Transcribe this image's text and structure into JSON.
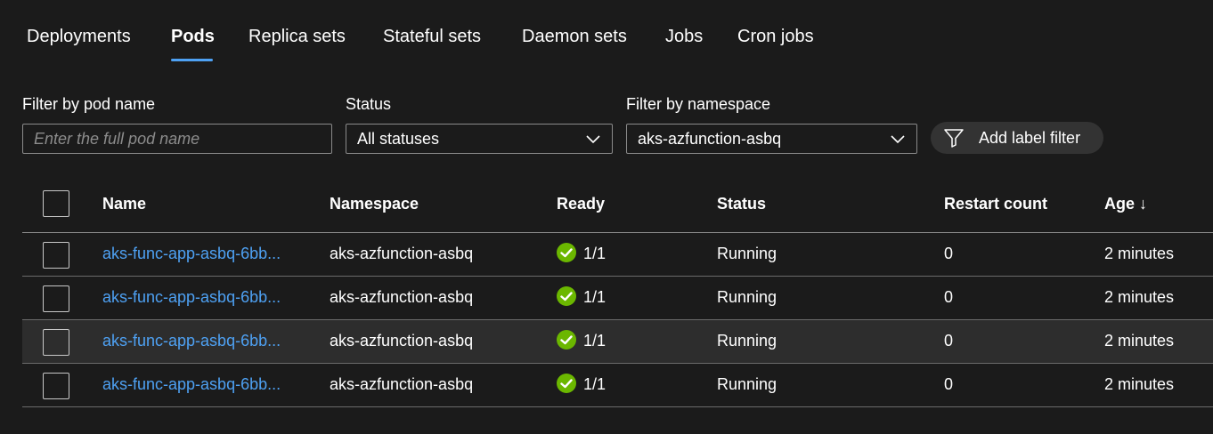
{
  "tabs": {
    "deployments": "Deployments",
    "pods": "Pods",
    "replica_sets": "Replica sets",
    "stateful_sets": "Stateful sets",
    "daemon_sets": "Daemon sets",
    "jobs": "Jobs",
    "cron_jobs": "Cron jobs",
    "active": "Pods"
  },
  "filters": {
    "pod_name_label": "Filter by pod name",
    "pod_name_placeholder": "Enter the full pod name",
    "pod_name_value": "",
    "status_label": "Status",
    "status_value": "All statuses",
    "namespace_label": "Filter by namespace",
    "namespace_value": "aks-azfunction-asbq",
    "add_label_filter": "Add label filter"
  },
  "table": {
    "columns": {
      "name": "Name",
      "namespace": "Namespace",
      "ready": "Ready",
      "status": "Status",
      "restart_count": "Restart count",
      "age": "Age ↓"
    },
    "rows": [
      {
        "name": "aks-func-app-asbq-6bb...",
        "namespace": "aks-azfunction-asbq",
        "ready": "1/1",
        "status": "Running",
        "restart_count": "0",
        "age": "2 minutes"
      },
      {
        "name": "aks-func-app-asbq-6bb...",
        "namespace": "aks-azfunction-asbq",
        "ready": "1/1",
        "status": "Running",
        "restart_count": "0",
        "age": "2 minutes"
      },
      {
        "name": "aks-func-app-asbq-6bb...",
        "namespace": "aks-azfunction-asbq",
        "ready": "1/1",
        "status": "Running",
        "restart_count": "0",
        "age": "2 minutes"
      },
      {
        "name": "aks-func-app-asbq-6bb...",
        "namespace": "aks-azfunction-asbq",
        "ready": "1/1",
        "status": "Running",
        "restart_count": "0",
        "age": "2 minutes"
      }
    ]
  },
  "icons": {
    "ready": "check-circle-icon",
    "dropdown": "chevron-down-icon",
    "label_filter": "filter-icon"
  },
  "colors": {
    "accent": "#4ea1f3",
    "success": "#6bb700",
    "background": "#1b1b1b"
  }
}
